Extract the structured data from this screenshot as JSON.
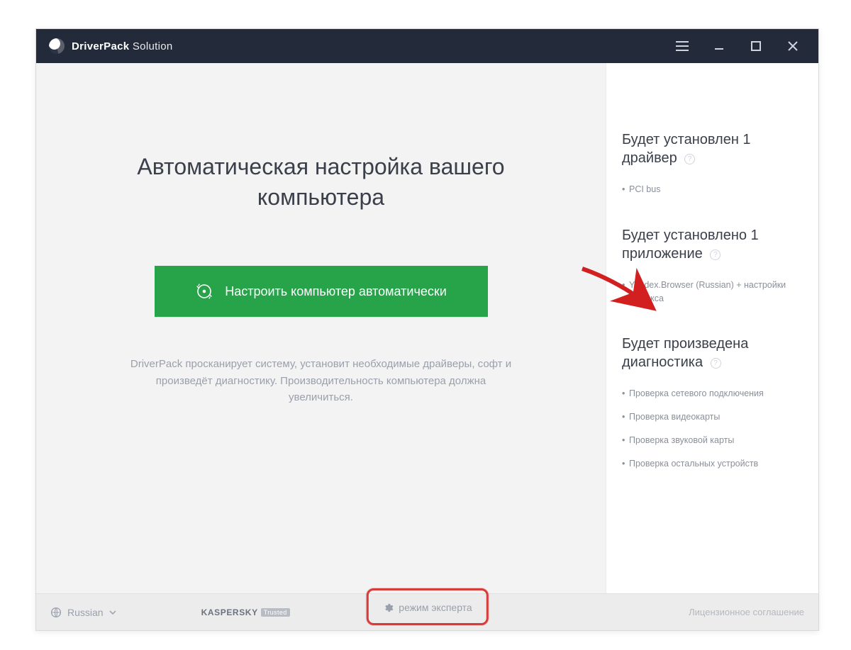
{
  "titlebar": {
    "brand_strong": "DriverPack",
    "brand_light": " Solution"
  },
  "main": {
    "headline": "Автоматическая настройка вашего компьютера",
    "cta_label": "Настроить компьютер автоматически",
    "description": "DriverPack просканирует систему, установит необходимые драйверы, софт и произведёт диагностику. Производительность компьютера должна увеличиться."
  },
  "sidebar": {
    "groups": [
      {
        "title": "Будет установлен 1 драйвер",
        "help": "?",
        "items": [
          "PCI bus"
        ]
      },
      {
        "title": "Будет установлено 1 приложение",
        "help": "?",
        "items": [
          "Yandex.Browser (Russian) + настройки Яндекса"
        ]
      },
      {
        "title": "Будет произведена диагностика",
        "help": "?",
        "items": [
          "Проверка сетевого подключения",
          "Проверка видеокарты",
          "Проверка звуковой карты",
          "Проверка остальных устройств"
        ]
      }
    ]
  },
  "footer": {
    "language": "Russian",
    "kaspersky_label": "KASPERSKY",
    "kaspersky_badge": "Trusted",
    "expert_label": "режим эксперта",
    "license": "Лицензионное соглашение"
  }
}
